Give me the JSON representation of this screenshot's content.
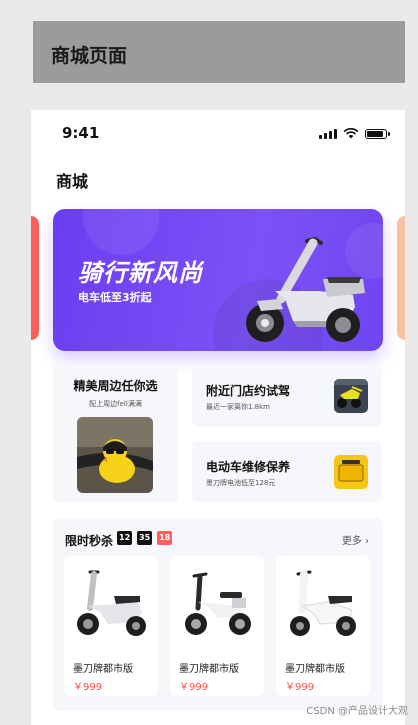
{
  "title_bar": {
    "text": "商城页面"
  },
  "status_bar": {
    "time": "9:41"
  },
  "page": {
    "heading": "商城"
  },
  "banner": {
    "title": "骑行新风尚",
    "subtitle": "电车低至3折起"
  },
  "cards": {
    "peripherals": {
      "title": "精美周边任你选",
      "subtitle": "配上周边fell满满"
    },
    "nearby_store": {
      "title": "附近门店约试驾",
      "subtitle": "最近一家离你1.8km"
    },
    "repair": {
      "title": "电动车维修保养",
      "subtitle": "墨刀牌电池低至128元"
    }
  },
  "flash_sale": {
    "title": "限时秒杀",
    "timer": {
      "hours": "12",
      "minutes": "35",
      "seconds": "18"
    },
    "more_label": "更多 ›",
    "products": [
      {
        "name": "墨刀牌都市版",
        "price": "￥999"
      },
      {
        "name": "墨刀牌都市版",
        "price": "￥999"
      },
      {
        "name": "墨刀牌都市版",
        "price": "￥999"
      }
    ]
  },
  "watermark": "CSDN @产品设计大观",
  "colors": {
    "brand_purple": "#6b3df1",
    "accent_red": "#ff5e5a",
    "price_red": "#ff4b43"
  }
}
